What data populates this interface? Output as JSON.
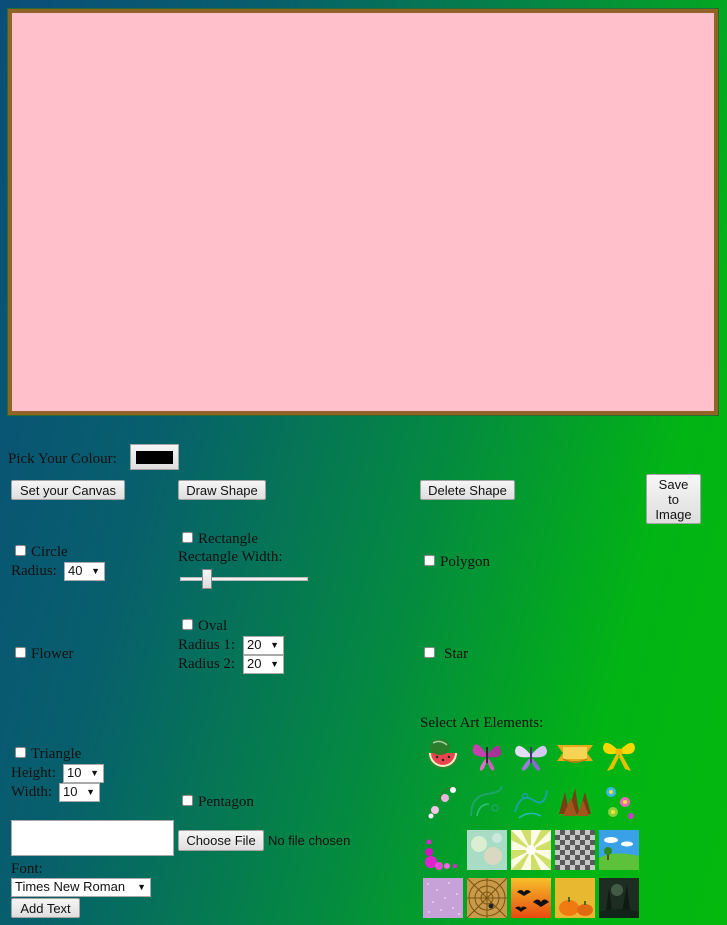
{
  "canvas": {
    "background": "#ffc0cb",
    "border": "#8f6424"
  },
  "colour_picker": {
    "label": "Pick Your Colour:",
    "value": "#000000"
  },
  "toolbar": {
    "set_canvas": "Set your Canvas",
    "draw_shape": "Draw Shape",
    "delete_shape": "Delete Shape",
    "save_line1": "Save",
    "save_line2": "to",
    "save_line3": "Image"
  },
  "shapes": {
    "circle": {
      "label": "Circle",
      "radius_label": "Radius:",
      "radius_value": "40"
    },
    "rectangle": {
      "label": "Rectangle",
      "width_label": "Rectangle Width:",
      "width_fraction": 0.2
    },
    "polygon": {
      "label": "Polygon"
    },
    "flower": {
      "label": "Flower"
    },
    "oval": {
      "label": "Oval",
      "radius1_label": "Radius 1:",
      "radius1_value": "20",
      "radius2_label": "Radius 2:",
      "radius2_value": "20"
    },
    "star": {
      "label": "Star"
    },
    "triangle": {
      "label": "Triangle",
      "height_label": "Height:",
      "height_value": "10",
      "width_label": "Width:",
      "width_value": "10"
    },
    "pentagon": {
      "label": "Pentagon"
    }
  },
  "text_tool": {
    "choose_file": "Choose File",
    "file_status": "No file chosen",
    "font_label": "Font:",
    "font_value": "Times New Roman",
    "add_text": "Add Text"
  },
  "art": {
    "label": "Select Art Elements:",
    "items": [
      "watermelon-icon",
      "pink-butterfly-icon",
      "purple-butterfly-icon",
      "gold-ribbon-icon",
      "yellow-bow-icon",
      "flower-corner-icon",
      "green-swirl-icon",
      "teal-swirl-icon",
      "brown-leaves-icon",
      "flower-cluster-icon",
      "pink-floral-corner-icon",
      "floral-background-icon",
      "sunburst-background-icon",
      "checker-pattern-icon",
      "landscape-icon",
      "lilac-glitter-icon",
      "spiderweb-icon",
      "halloween-bats-icon",
      "pumpkins-icon",
      "dark-forest-icon"
    ]
  }
}
